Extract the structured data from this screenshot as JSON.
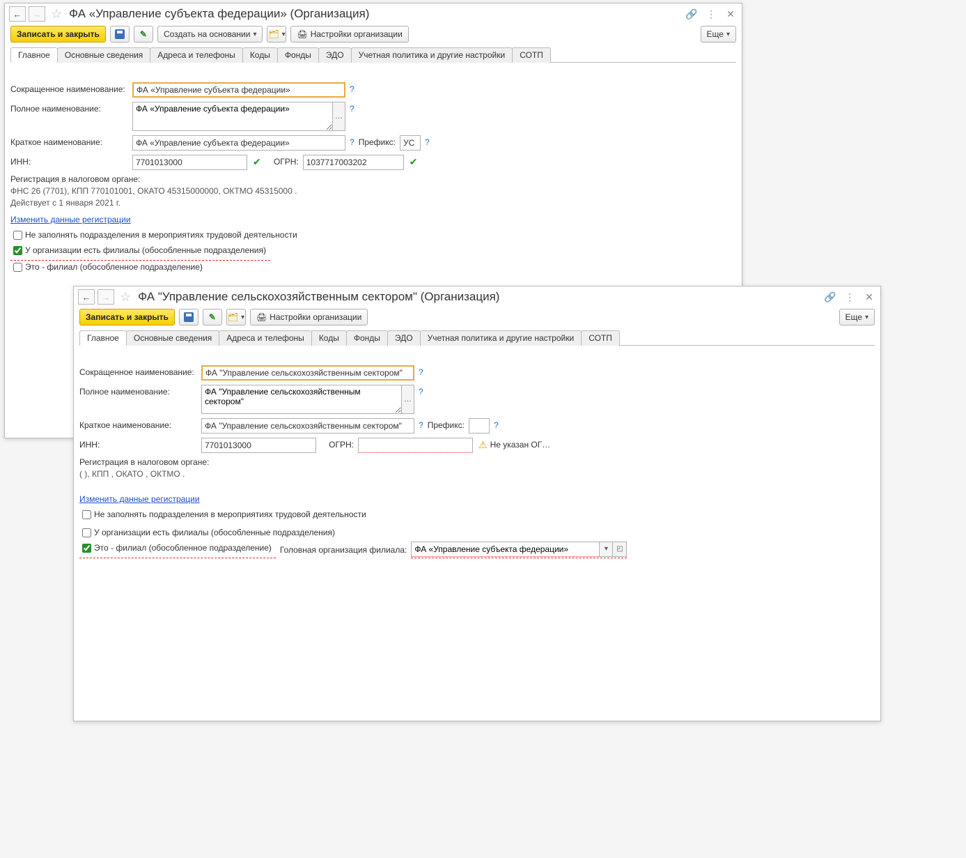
{
  "window1": {
    "title": "ФА «Управление субъекта федерации» (Организация)",
    "toolbar": {
      "save_close": "Записать и закрыть",
      "create_based": "Создать на основании",
      "org_settings": "Настройки организации",
      "more": "Еще"
    },
    "tabs": [
      "Главное",
      "Основные сведения",
      "Адреса и телефоны",
      "Коды",
      "Фонды",
      "ЭДО",
      "Учетная политика и другие настройки",
      "СОТП"
    ],
    "labels": {
      "short_name": "Сокращенное наименование:",
      "full_name": "Полное наименование:",
      "brief_name": "Краткое наименование:",
      "inn": "ИНН:",
      "ogrn": "ОГРН:",
      "prefix": "Префикс:",
      "reg_header": "Регистрация в налоговом органе:",
      "reg_text": "ФНС 26 (7701), КПП 770101001, ОКАТО 45315000000, ОКТМО 45315000   . Действует с 1 января 2021 г.",
      "change_reg": "Изменить данные регистрации",
      "cb_no_fill": "Не заполнять подразделения в мероприятиях трудовой деятельности",
      "cb_has_branches": "У организации есть филиалы (обособленные подразделения)",
      "cb_is_branch": "Это - филиал (обособленное подразделение)"
    },
    "values": {
      "short_name": "ФА «Управление субъекта федерации»",
      "full_name": "ФА «Управление субъекта федерации»",
      "brief_name": "ФА «Управление субъекта федерации»",
      "inn": "7701013000",
      "ogrn": "1037717003202",
      "prefix": "УС"
    }
  },
  "window2": {
    "title": "ФА \"Управление сельскохозяйственным сектором\" (Организация)",
    "toolbar": {
      "save_close": "Записать и закрыть",
      "org_settings": "Настройки организации",
      "more": "Еще"
    },
    "tabs": [
      "Главное",
      "Основные сведения",
      "Адреса и телефоны",
      "Коды",
      "Фонды",
      "ЭДО",
      "Учетная политика и другие настройки",
      "СОТП"
    ],
    "labels": {
      "short_name": "Сокращенное наименование:",
      "full_name": "Полное наименование:",
      "brief_name": "Краткое наименование:",
      "inn": "ИНН:",
      "ogrn": "ОГРН:",
      "prefix": "Префикс:",
      "reg_header": "Регистрация в налоговом органе:",
      "reg_text": "(   ), КПП , ОКАТО , ОКТМО .",
      "change_reg": "Изменить данные регистрации",
      "cb_no_fill": "Не заполнять подразделения в мероприятиях трудовой деятельности",
      "cb_has_branches": "У организации есть филиалы (обособленные подразделения)",
      "cb_is_branch": "Это - филиал (обособленное подразделение)",
      "head_org": "Головная организация филиала:",
      "ogrn_warn": "Не указан ОГ…"
    },
    "values": {
      "short_name": "ФА \"Управление сельскохозяйственным сектором\"",
      "full_name": "ФА \"Управление сельскохозяйственным сектором\"",
      "brief_name": "ФА \"Управление сельскохозяйственным сектором\"",
      "inn": "7701013000",
      "ogrn": "",
      "prefix": "",
      "head_org": "ФА «Управление субъекта федерации»"
    }
  },
  "help_q": "?"
}
